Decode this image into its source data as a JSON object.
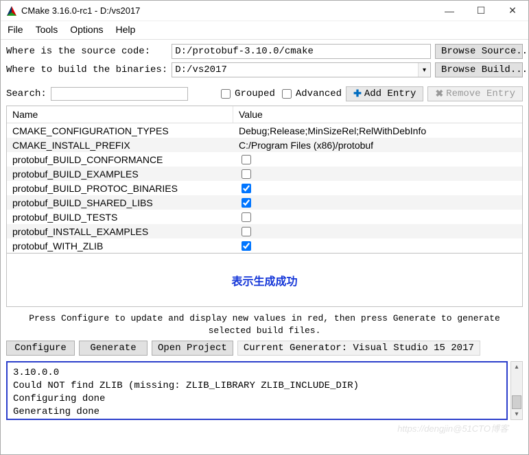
{
  "titlebar": {
    "title": "CMake 3.16.0-rc1 - D:/vs2017"
  },
  "menu": {
    "file": "File",
    "tools": "Tools",
    "options": "Options",
    "help": "Help"
  },
  "form": {
    "source_label": "Where is the source code:   ",
    "source_value": "D:/protobuf-3.10.0/cmake",
    "browse_source": "Browse Source...",
    "build_label": "Where to build the binaries:",
    "build_value": "D:/vs2017",
    "browse_build": "Browse Build... "
  },
  "search": {
    "label": "Search:",
    "value": "",
    "grouped": "Grouped",
    "advanced": "Advanced",
    "add_entry": "Add Entry",
    "remove_entry": "Remove Entry"
  },
  "table": {
    "header_name": "Name",
    "header_value": "Value",
    "rows": [
      {
        "name": "CMAKE_CONFIGURATION_TYPES",
        "value_text": "Debug;Release;MinSizeRel;RelWithDebInfo",
        "type": "text"
      },
      {
        "name": "CMAKE_INSTALL_PREFIX",
        "value_text": "C:/Program Files (x86)/protobuf",
        "type": "text"
      },
      {
        "name": "protobuf_BUILD_CONFORMANCE",
        "checked": false,
        "type": "bool"
      },
      {
        "name": "protobuf_BUILD_EXAMPLES",
        "checked": false,
        "type": "bool"
      },
      {
        "name": "protobuf_BUILD_PROTOC_BINARIES",
        "checked": true,
        "type": "bool"
      },
      {
        "name": "protobuf_BUILD_SHARED_LIBS",
        "checked": true,
        "type": "bool"
      },
      {
        "name": "protobuf_BUILD_TESTS",
        "checked": false,
        "type": "bool"
      },
      {
        "name": "protobuf_INSTALL_EXAMPLES",
        "checked": false,
        "type": "bool"
      },
      {
        "name": "protobuf_WITH_ZLIB",
        "checked": true,
        "type": "bool"
      }
    ]
  },
  "annotation": "表示生成成功",
  "hint": "Press Configure to update and display new values in red,  then press Generate to generate\nselected build files.",
  "actions": {
    "configure": "Configure",
    "generate": "Generate",
    "open_project": "Open Project",
    "generator_label": "Current Generator: Visual Studio 15 2017"
  },
  "output_lines": [
    "3.10.0.0",
    "Could NOT find ZLIB (missing: ZLIB_LIBRARY ZLIB_INCLUDE_DIR)",
    "Configuring done",
    "Generating done"
  ],
  "watermark": "https://dengjin@51CTO博客"
}
